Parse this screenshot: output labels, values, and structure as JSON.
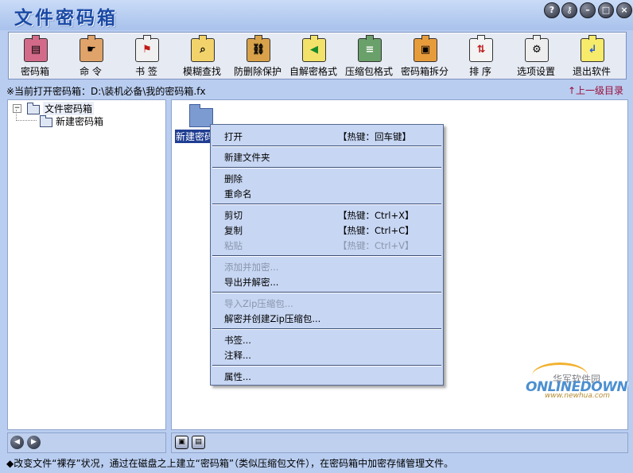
{
  "app": {
    "title": "文件密码箱",
    "window_buttons": {
      "help": "?",
      "key": "⚷",
      "minimize": "–",
      "maximize": "□",
      "close": "×"
    }
  },
  "toolbar": {
    "items": [
      {
        "label": "密码箱",
        "icon": "password-box-icon",
        "color": "#d46a8a",
        "glyph": "▤"
      },
      {
        "label": "命  令",
        "icon": "command-hand-icon",
        "color": "#e0a36a",
        "glyph": "☛"
      },
      {
        "label": "书  签",
        "icon": "bookmark-icon",
        "color": "#f0f0f0",
        "glyph": "⚑"
      },
      {
        "label": "模糊查找",
        "icon": "search-icon",
        "color": "#f2d36b",
        "glyph": "⌕"
      },
      {
        "label": "防删除保护",
        "icon": "delete-protect-icon",
        "color": "#d9a24a",
        "glyph": "⛓"
      },
      {
        "label": "自解密格式",
        "icon": "self-decrypt-icon",
        "color": "#f3e26a",
        "glyph": "◀"
      },
      {
        "label": "压缩包格式",
        "icon": "archive-format-icon",
        "color": "#6aa06a",
        "glyph": "≡"
      },
      {
        "label": "密码箱拆分",
        "icon": "split-box-icon",
        "color": "#e79c3c",
        "glyph": "▣"
      },
      {
        "label": "排  序",
        "icon": "sort-icon",
        "color": "#f3f3f3",
        "glyph": "⇅"
      },
      {
        "label": "选项设置",
        "icon": "settings-icon",
        "color": "#eeeeee",
        "glyph": "⚙"
      },
      {
        "label": "退出软件",
        "icon": "exit-icon",
        "color": "#f6eb6a",
        "glyph": "↲"
      }
    ]
  },
  "path": {
    "text": "※当前打开密码箱：D:\\装机必备\\我的密码箱.fx",
    "up_link": "↑上一级目录"
  },
  "tree": {
    "root": {
      "label": "文件密码箱",
      "expander": "⊟"
    },
    "children": [
      {
        "label": "新建密码箱"
      }
    ]
  },
  "content": {
    "items": [
      {
        "label": "新建密码"
      }
    ]
  },
  "context_menu": {
    "items": [
      {
        "label": "打开",
        "hotkey": "【热键：回车键】",
        "enabled": true
      },
      {
        "label": "新建文件夹",
        "hotkey": "",
        "enabled": true
      },
      {
        "label": "删除",
        "hotkey": "",
        "enabled": true
      },
      {
        "label": "重命名",
        "hotkey": "",
        "enabled": true
      },
      {
        "label": "剪切",
        "hotkey": "【热键：Ctrl+X】",
        "enabled": true
      },
      {
        "label": "复制",
        "hotkey": "【热键：Ctrl+C】",
        "enabled": true
      },
      {
        "label": "粘贴",
        "hotkey": "【热键：Ctrl+V】",
        "enabled": false
      },
      {
        "label": "添加并加密...",
        "hotkey": "",
        "enabled": false
      },
      {
        "label": "导出并解密...",
        "hotkey": "",
        "enabled": true
      },
      {
        "label": "导入Zip压缩包...",
        "hotkey": "",
        "enabled": false
      },
      {
        "label": "解密并创建Zip压缩包...",
        "hotkey": "",
        "enabled": true
      },
      {
        "label": "书签...",
        "hotkey": "",
        "enabled": true
      },
      {
        "label": "注释...",
        "hotkey": "",
        "enabled": true
      },
      {
        "label": "属性...",
        "hotkey": "",
        "enabled": true
      }
    ]
  },
  "bottom_nav": {
    "left": {
      "back": "◀",
      "forward": "▶"
    },
    "right": {
      "view_icons": "▣",
      "view_list": "▤"
    }
  },
  "status": {
    "text": "◆改变文件“裸存”状况，通过在磁盘之上建立“密码箱”（类似压缩包文件），在密码箱中加密存储管理文件。"
  },
  "watermark": {
    "cn": "华军软件园",
    "en": "ONLINEDOWN",
    "url": "www.newhua.com"
  }
}
